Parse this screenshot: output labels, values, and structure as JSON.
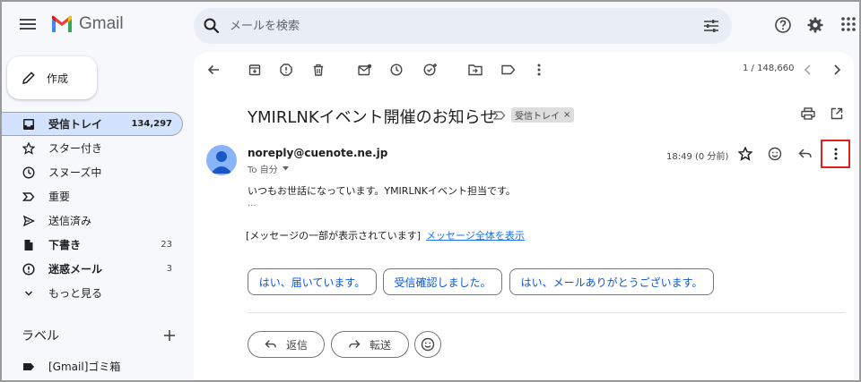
{
  "header": {
    "app_name": "Gmail",
    "search_placeholder": "メールを検索"
  },
  "sidebar": {
    "compose_label": "作成",
    "items": [
      {
        "label": "受信トレイ",
        "count": "134,297",
        "active": true
      },
      {
        "label": "スター付き",
        "count": ""
      },
      {
        "label": "スヌーズ中",
        "count": ""
      },
      {
        "label": "重要",
        "count": ""
      },
      {
        "label": "送信済み",
        "count": ""
      },
      {
        "label": "下書き",
        "count": "23"
      },
      {
        "label": "迷惑メール",
        "count": "3"
      },
      {
        "label": "もっと見る",
        "count": ""
      }
    ],
    "labels_title": "ラベル",
    "label_items": [
      {
        "label": "[Gmail]ゴミ箱"
      }
    ]
  },
  "toolbar": {
    "pager": "1 / 148,660"
  },
  "message": {
    "subject": "YMIRLNKイベント開催のお知らせ",
    "inbox_badge": "受信トレイ",
    "badge_close": "×",
    "sender": "noreply@cuenote.ne.jp",
    "to": "To 自分",
    "timestamp": "18:49 (0 分前)",
    "body_line": "いつもお世話になっています。YMIRLNKイベント担当です。",
    "ellipsis": "...",
    "clip_note": "[メッセージの一部が表示されています]",
    "clip_link": "メッセージ全体を表示"
  },
  "smart_replies": [
    "はい、届いています。",
    "受信確認しました。",
    "はい、メールありがとうございます。"
  ],
  "actions": {
    "reply_label": "返信",
    "forward_label": "転送"
  },
  "colors": {
    "accent": "#0b57d0",
    "link": "#1a73e8",
    "active_nav": "#d3e3fd",
    "highlight_box": "#e0201c"
  }
}
